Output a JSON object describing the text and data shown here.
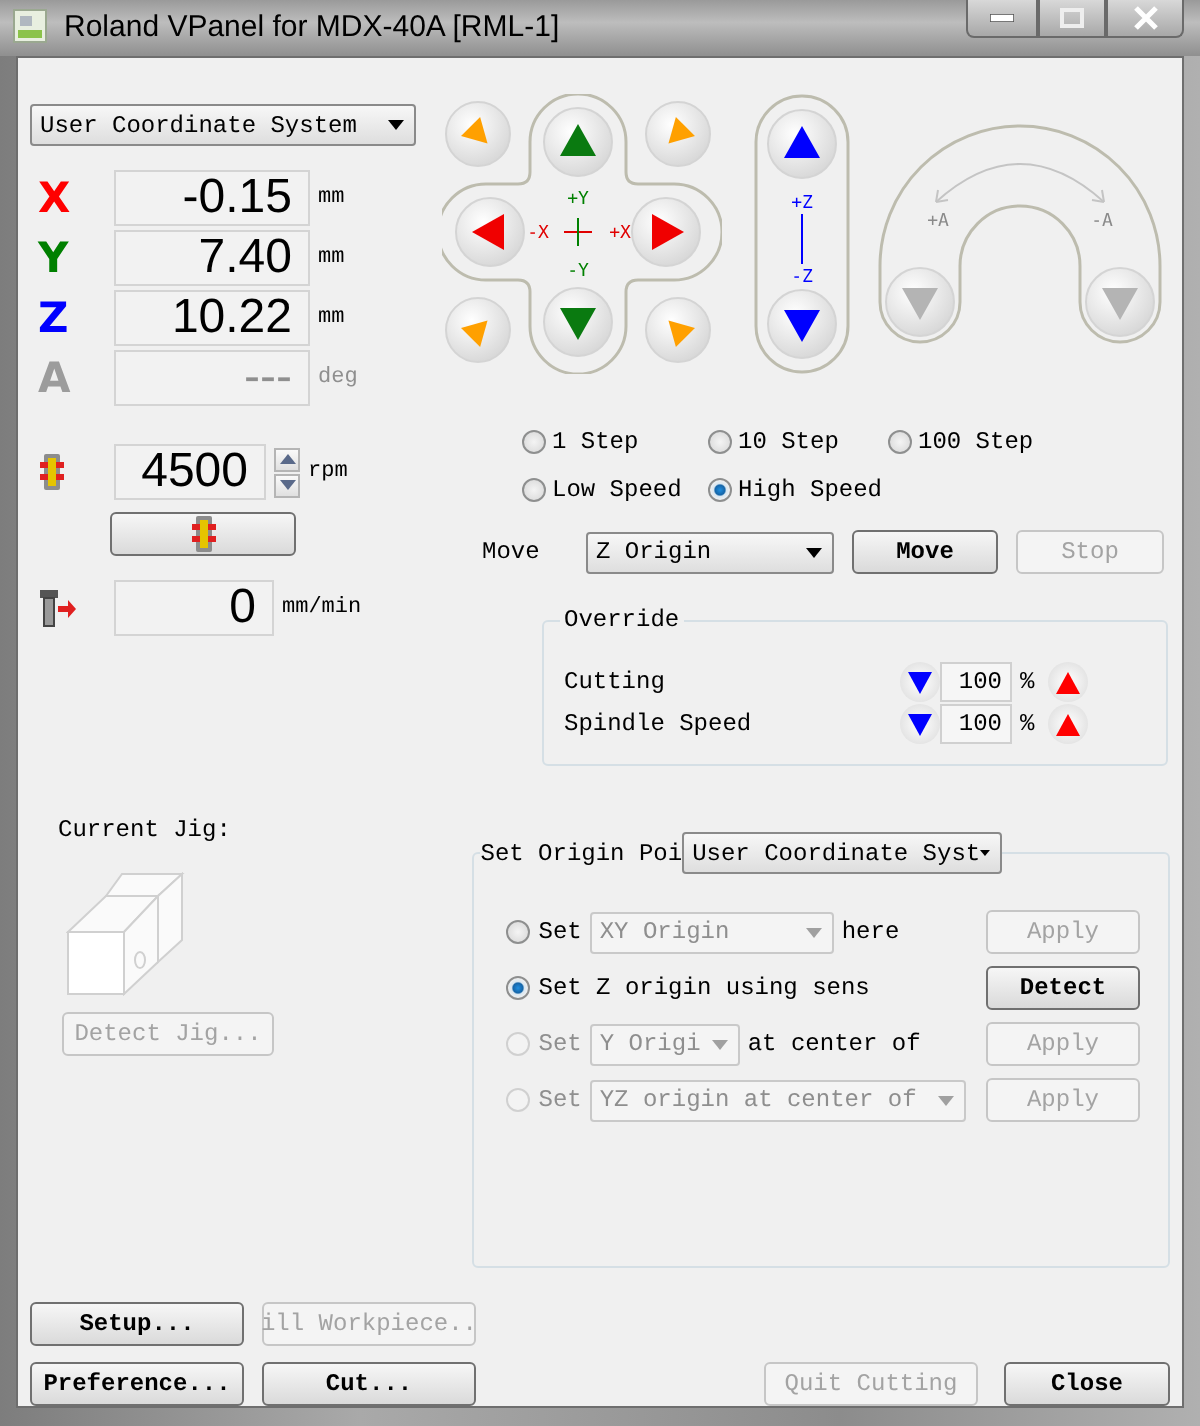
{
  "window": {
    "title": "Roland VPanel for MDX-40A [RML-1]"
  },
  "coordinate_system": {
    "value": "User Coordinate System"
  },
  "axes": [
    {
      "label": "X",
      "color": "#ff0000",
      "value": "-0.15",
      "unit": "mm",
      "disabled": false
    },
    {
      "label": "Y",
      "color": "#008000",
      "value": "7.40",
      "unit": "mm",
      "disabled": false
    },
    {
      "label": "Z",
      "color": "#0000ff",
      "value": "10.22",
      "unit": "mm",
      "disabled": false
    },
    {
      "label": "A",
      "color": "#9c9c9c",
      "value": "---",
      "unit": "deg",
      "disabled": true
    }
  ],
  "spindle": {
    "value": "4500",
    "unit": "rpm"
  },
  "feed": {
    "value": "0",
    "unit": "mm/min"
  },
  "xy_pad": {
    "labels": [
      "+Y",
      "-X",
      "+X",
      "-Y"
    ]
  },
  "z_pad": {
    "labels": [
      "+Z",
      "-Z"
    ]
  },
  "a_pad": {
    "labels": [
      "+A",
      "-A"
    ],
    "disabled": true
  },
  "step_options": [
    {
      "label": "1 Step",
      "selected": false
    },
    {
      "label": "10 Step",
      "selected": false
    },
    {
      "label": "100 Step",
      "selected": false
    }
  ],
  "speed_options": [
    {
      "label": "Low Speed",
      "selected": false
    },
    {
      "label": "High Speed",
      "selected": true
    }
  ],
  "move": {
    "label": "Move",
    "target": "Z Origin",
    "buttons": [
      {
        "label": "Move",
        "disabled": false
      },
      {
        "label": "Stop",
        "disabled": true
      }
    ]
  },
  "override": {
    "title": "Override",
    "rows": [
      {
        "label": "Cutting",
        "value": "100",
        "unit": "%"
      },
      {
        "label": "Spindle Speed",
        "value": "100",
        "unit": "%"
      }
    ]
  },
  "current_jig": {
    "label": "Current Jig:",
    "button": {
      "label": "Detect Jig...",
      "disabled": true
    }
  },
  "set_origin": {
    "title": "Set Origin Poi",
    "system": "User Coordinate Syst",
    "options": [
      {
        "kind": "select",
        "prefix": "Set",
        "select": "XY Origin",
        "suffix": "here",
        "selected": false,
        "disabled": false,
        "button": {
          "label": "Apply",
          "disabled": true
        }
      },
      {
        "kind": "text",
        "prefix": "Set Z origin using sens",
        "selected": true,
        "disabled": false,
        "button": {
          "label": "Detect",
          "disabled": false
        }
      },
      {
        "kind": "select",
        "prefix": "Set",
        "select": "Y Origi",
        "suffix": "at center of",
        "selected": false,
        "disabled": true,
        "button": {
          "label": "Apply",
          "disabled": true
        }
      },
      {
        "kind": "select",
        "prefix": "Set",
        "select": "YZ origin at center of",
        "selected": false,
        "disabled": true,
        "button": {
          "label": "Apply",
          "disabled": true
        }
      }
    ]
  },
  "footer": {
    "left": [
      {
        "label": "Setup...",
        "disabled": false
      },
      {
        "label": "ill Workpiece..",
        "disabled": true
      },
      {
        "label": "Preference...",
        "disabled": false
      },
      {
        "label": "Cut...",
        "disabled": false
      }
    ],
    "right": [
      {
        "label": "Quit Cutting",
        "disabled": true
      },
      {
        "label": "Close",
        "disabled": false
      }
    ]
  }
}
